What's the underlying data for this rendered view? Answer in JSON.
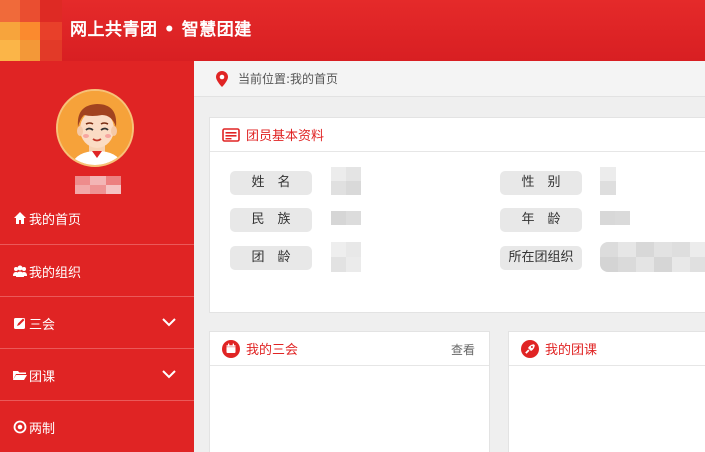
{
  "header": {
    "title": "网上共青团 • 智慧团建"
  },
  "sidebar": {
    "items": [
      {
        "label": "我的首页",
        "icon": "home-icon"
      },
      {
        "label": "我的组织",
        "icon": "group-icon"
      },
      {
        "label": "三会",
        "icon": "edit-icon",
        "expandable": true
      },
      {
        "label": "团课",
        "icon": "folder-icon",
        "expandable": true
      },
      {
        "label": "两制",
        "icon": "target-icon"
      }
    ]
  },
  "breadcrumb": {
    "text": "当前位置:我的首页",
    "icon": "location-pin-icon"
  },
  "profile_card": {
    "title": "团员基本资料",
    "icon": "id-card-icon",
    "labels": {
      "name": "姓　名",
      "gender": "性　别",
      "ethnicity": "民　族",
      "age": "年　龄",
      "league_age": "团　龄",
      "organization": "所在团组织"
    }
  },
  "meetings_card": {
    "title": "我的三会",
    "more": "查看",
    "icon": "calendar-icon"
  },
  "lessons_card": {
    "title": "我的团课",
    "icon": "rocket-icon"
  },
  "colors": {
    "brand_red": "#e02424",
    "label_bg": "#e8e8e8"
  }
}
